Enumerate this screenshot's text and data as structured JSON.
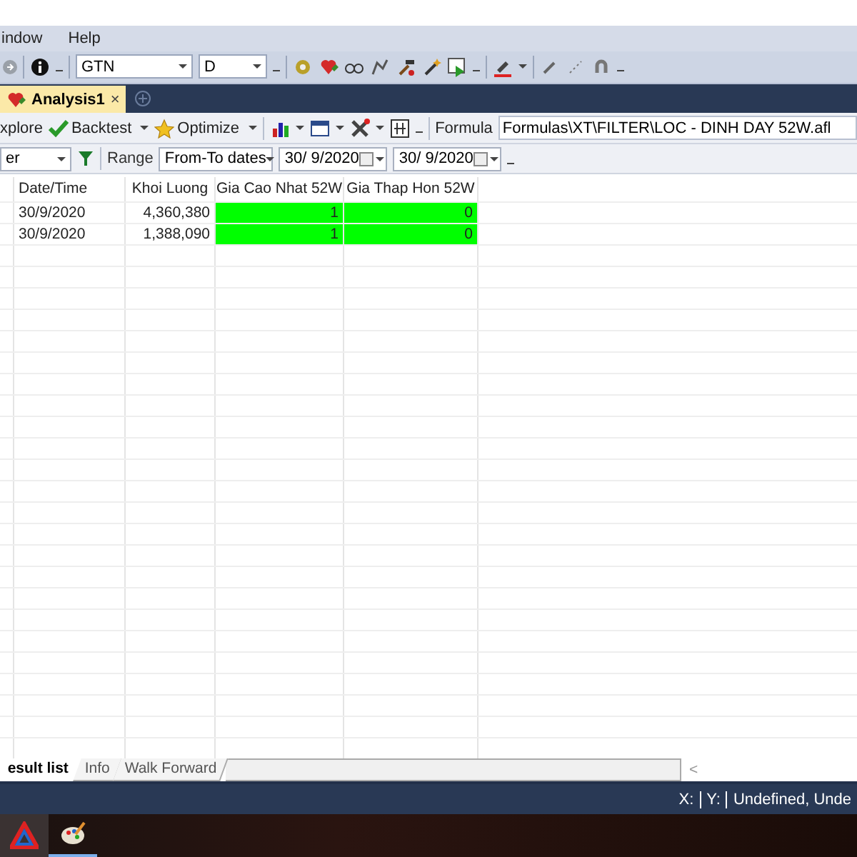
{
  "menu": [
    "indow",
    "Help"
  ],
  "main_toolbar": {
    "symbol": "GTN",
    "interval": "D"
  },
  "doc_tabs": [
    {
      "label": "Analysis1",
      "selected": true,
      "close": "×"
    }
  ],
  "analysis_toolbar": {
    "buttons": [
      {
        "label": "xplore",
        "kind": "plain"
      },
      {
        "label": "Backtest",
        "kind": "check"
      },
      {
        "label": "Optimize",
        "kind": "star"
      }
    ],
    "formula_label": "Formula",
    "formula": "Formulas\\XT\\FILTER\\LOC - DINH DAY 52W.afl"
  },
  "filter_bar": {
    "apply_to": "er",
    "range_label": "Range",
    "range": "From-To dates",
    "from_date": "30/ 9/2020",
    "to_date": "30/ 9/2020"
  },
  "table": {
    "columns": [
      "Date/Time",
      "Khoi Luong",
      "Gia Cao Nhat 52W",
      "Gia Thap Hon 52W"
    ],
    "rows": [
      {
        "cells": [
          {
            "text": "30/9/2020"
          },
          {
            "text": "4,360,380"
          },
          {
            "text": "1",
            "color": "#00ff00"
          },
          {
            "text": "0",
            "color": "#00ff00"
          }
        ]
      },
      {
        "cells": [
          {
            "text": "30/9/2020"
          },
          {
            "text": "1,388,090"
          },
          {
            "text": "1",
            "color": "#00ff00"
          },
          {
            "text": "0",
            "color": "#00ff00"
          }
        ]
      }
    ]
  },
  "sheet_tabs": [
    {
      "label": "esult list",
      "selected": true
    },
    {
      "label": "Info",
      "selected": false
    },
    {
      "label": "Walk Forward",
      "selected": false
    }
  ],
  "scroll_left": "<",
  "status_bar": [
    "X:",
    "Y:",
    "Undefined, Unde"
  ]
}
